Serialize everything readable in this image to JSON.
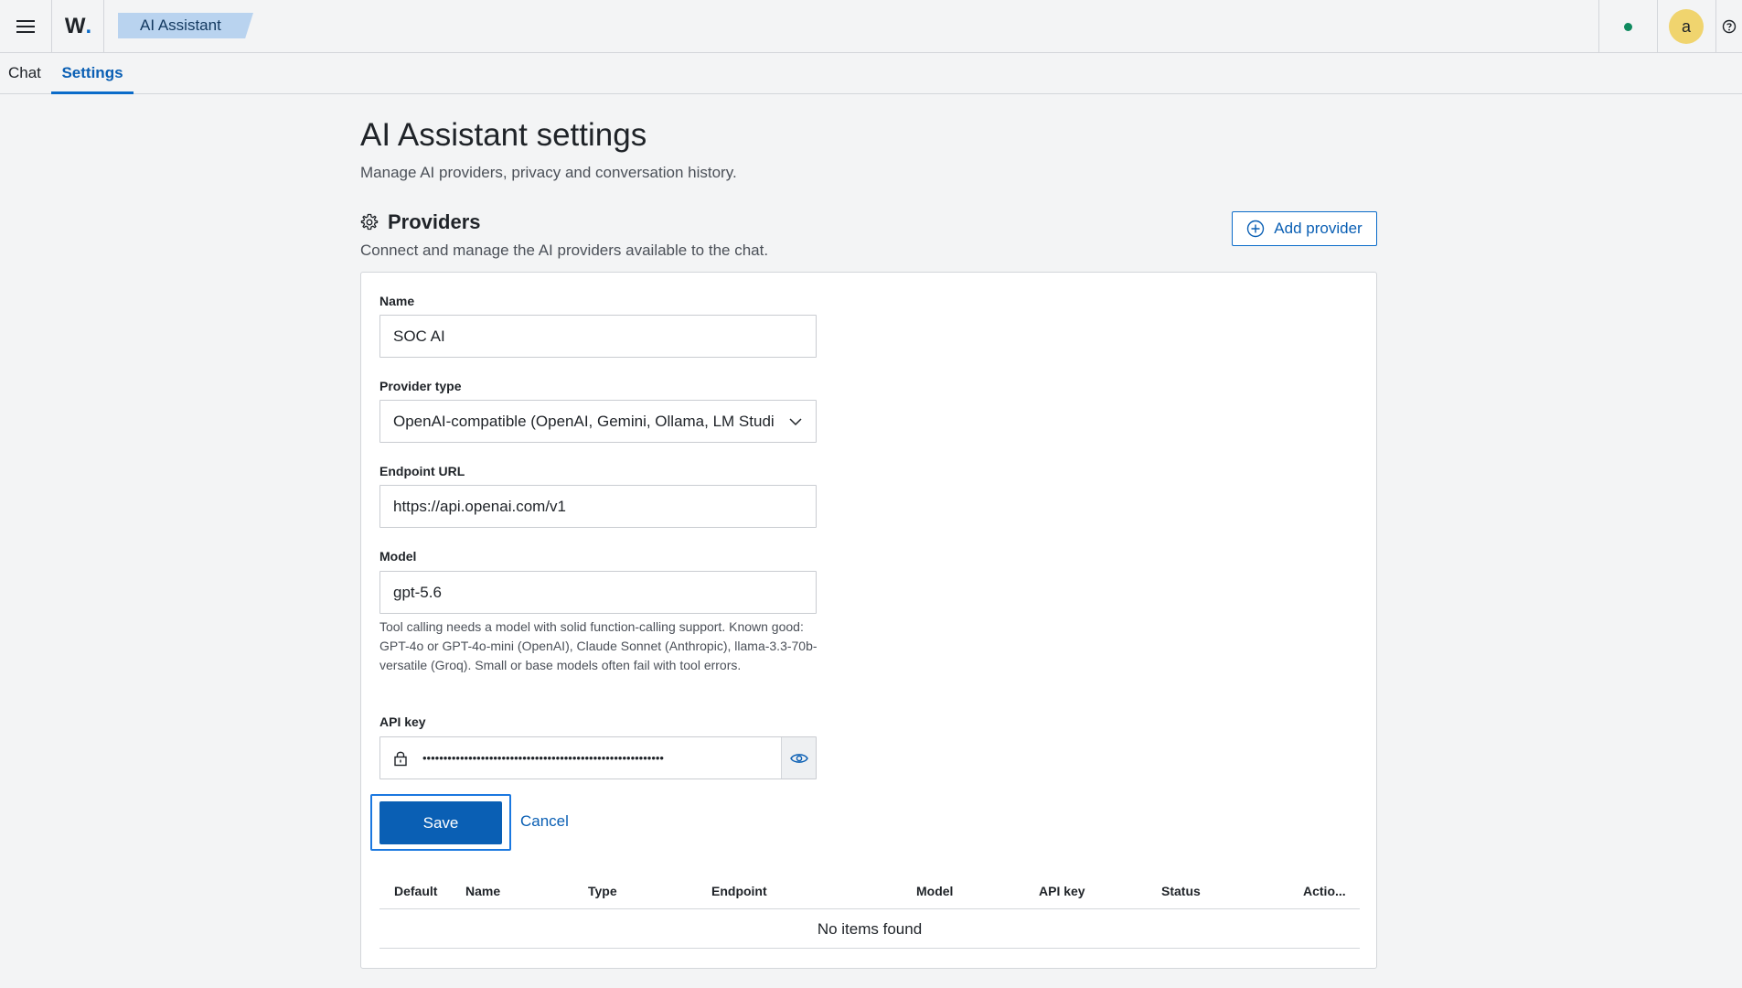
{
  "header": {
    "app_name": "AI Assistant",
    "logo_text": "W",
    "logo_dot": ".",
    "avatar_initial": "a",
    "status_color": "#0f8a5f",
    "brand_color": "#0a6bc9"
  },
  "tabs": [
    {
      "label": "Chat",
      "active": false
    },
    {
      "label": "Settings",
      "active": true
    }
  ],
  "page": {
    "title": "AI Assistant settings",
    "subtitle": "Manage AI providers, privacy and conversation history."
  },
  "providers": {
    "title": "Providers",
    "description": "Connect and manage the AI providers available to the chat.",
    "add_button": "Add provider",
    "icon": "gear-icon"
  },
  "form": {
    "name_label": "Name",
    "name_value": "SOC AI",
    "type_label": "Provider type",
    "type_value": "OpenAI-compatible (OpenAI, Gemini, Ollama, LM Studi",
    "endpoint_label": "Endpoint URL",
    "endpoint_value": "https://api.openai.com/v1",
    "model_label": "Model",
    "model_value": "gpt-5.6",
    "model_help": "Tool calling needs a model with solid function-calling support. Known good: GPT-4o or GPT-4o-mini (OpenAI), Claude Sonnet (Anthropic), llama-3.3-70b-versatile (Groq). Small or base models often fail with tool errors.",
    "api_key_label": "API key",
    "api_key_masked": "••••••••••••••••••••••••••••••••••••••••••••••••••••••••••",
    "save_label": "Save",
    "cancel_label": "Cancel"
  },
  "table": {
    "columns": [
      "Default",
      "Name",
      "Type",
      "Endpoint",
      "Model",
      "API key",
      "Status",
      "Actio..."
    ],
    "empty_text": "No items found"
  }
}
